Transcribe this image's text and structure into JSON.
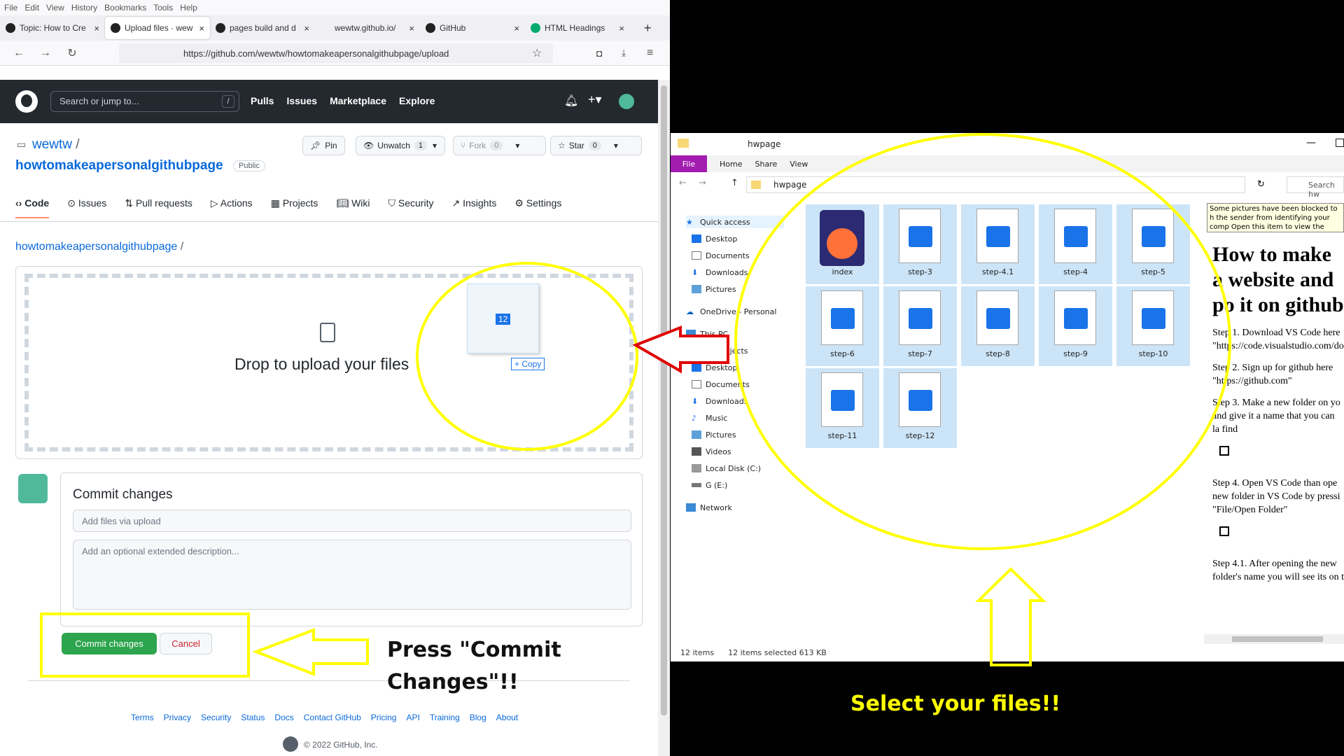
{
  "browser": {
    "menu": [
      "File",
      "Edit",
      "View",
      "History",
      "Bookmarks",
      "Tools",
      "Help"
    ],
    "tabs": [
      {
        "label": "Topic: How to Cre"
      },
      {
        "label": "Upload files · wew"
      },
      {
        "label": "pages build and d"
      },
      {
        "label": "wewtw.github.io/"
      },
      {
        "label": "GitHub"
      },
      {
        "label": "HTML Headings"
      }
    ],
    "url": "https://github.com/wewtw/howtomakeapersonalgithubpage/upload"
  },
  "github": {
    "search_placeholder": "Search or jump to...",
    "search_key": "/",
    "nav": [
      "Pulls",
      "Issues",
      "Marketplace",
      "Explore"
    ],
    "owner": "wewtw",
    "repo": "howtomakeapersonalgithubpage",
    "visibility": "Public",
    "pin_label": "Pin",
    "unwatch_label": "Unwatch",
    "unwatch_count": "1",
    "fork_label": "Fork",
    "fork_count": "0",
    "star_label": "Star",
    "star_count": "0",
    "tabs": [
      "Code",
      "Issues",
      "Pull requests",
      "Actions",
      "Projects",
      "Wiki",
      "Security",
      "Insights",
      "Settings"
    ],
    "breadcrumb": "howtomakeapersonalgithubpage",
    "drop_text": "Drop to upload your files",
    "drag_badge": "12",
    "copy_badge": "+ Copy",
    "commit_title": "Commit changes",
    "summary_placeholder": "Add files via upload",
    "description_placeholder": "Add an optional extended description...",
    "commit_button": "Commit changes",
    "cancel_button": "Cancel",
    "footer": [
      "Terms",
      "Privacy",
      "Security",
      "Status",
      "Docs",
      "Contact GitHub",
      "Pricing",
      "API",
      "Training",
      "Blog",
      "About"
    ],
    "copyright": "© 2022 GitHub, Inc."
  },
  "explorer": {
    "title": "hwpage",
    "ribbon": [
      "File",
      "Home",
      "Share",
      "View"
    ],
    "address": "hwpage",
    "search": "Search hw",
    "nav": [
      "Quick access",
      "Desktop",
      "Documents",
      "Downloads",
      "Pictures",
      "OneDrive - Personal",
      "This PC",
      "3D Objects",
      "Desktop",
      "Documents",
      "Downloads",
      "Music",
      "Pictures",
      "Videos",
      "Local Disk (C:)",
      "G (E:)",
      "Network"
    ],
    "files": [
      "index",
      "step-3",
      "step-4.1",
      "step-4",
      "step-5",
      "step-6",
      "step-7",
      "step-8",
      "step-9",
      "step-10",
      "step-11",
      "step-12"
    ],
    "status_count": "12 items",
    "status_selected": "12 items selected  613 KB",
    "blocked_notice": "Some pictures have been blocked to h the sender from identifying your comp Open this item to view the pictures."
  },
  "preview": {
    "heading": "How to make a website and po it on github",
    "steps": [
      "Step 1. Download VS Code here \"https://code.visualstudio.com/do",
      "Step 2. Sign up for github here \"https://github.com\"",
      "Step 3. Make a new folder on yo and give it a name that you can la find",
      "Step 4. Open VS Code than ope new folder in VS Code by pressi \"File/Open Folder\"",
      "Step 4.1. After opening the new folder's name you will see its on t"
    ]
  },
  "annotations": {
    "commit_hint": "Press \"Commit Changes\"!!",
    "select_hint": "Select your files!!"
  },
  "colors": {
    "highlight": "#ffff00",
    "arrow_red": "#e00000",
    "gh_green": "#2da44e",
    "gh_header": "#24292f"
  }
}
